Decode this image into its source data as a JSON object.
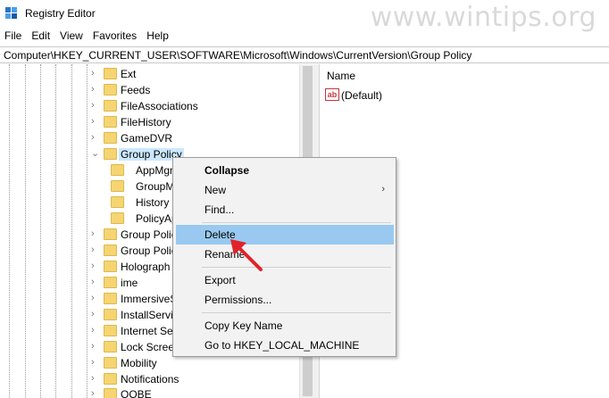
{
  "window": {
    "title": "Registry Editor",
    "watermark": "www.wintips.org"
  },
  "menu": [
    "File",
    "Edit",
    "View",
    "Favorites",
    "Help"
  ],
  "address": "Computer\\HKEY_CURRENT_USER\\SOFTWARE\\Microsoft\\Windows\\CurrentVersion\\Group Policy",
  "tree": {
    "items": [
      {
        "label": "Ext",
        "expander": "›"
      },
      {
        "label": "Feeds",
        "expander": "›"
      },
      {
        "label": "FileAssociations",
        "expander": "›"
      },
      {
        "label": "FileHistory",
        "expander": "›"
      },
      {
        "label": "GameDVR",
        "expander": "›"
      },
      {
        "label": "Group Policy",
        "expander": "⌄"
      },
      {
        "label": "Group Polic",
        "expander": "›"
      },
      {
        "label": "Group Polic",
        "expander": "›"
      },
      {
        "label": "Holograph",
        "expander": "›"
      },
      {
        "label": "ime",
        "expander": "›"
      },
      {
        "label": "ImmersiveS",
        "expander": "›"
      },
      {
        "label": "InstallServi",
        "expander": "›"
      },
      {
        "label": "Internet Set",
        "expander": "›"
      },
      {
        "label": "Lock Screen",
        "expander": "›"
      },
      {
        "label": "Mobility",
        "expander": "›"
      },
      {
        "label": "Notifications",
        "expander": "›"
      },
      {
        "label": "OOBE",
        "expander": "›"
      }
    ],
    "subitems": [
      {
        "label": "AppMgm"
      },
      {
        "label": "GroupM"
      },
      {
        "label": "History"
      },
      {
        "label": "PolicyAp"
      }
    ]
  },
  "values": {
    "column_name": "Name",
    "icon_text": "ab",
    "rows": [
      {
        "name": "(Default)"
      }
    ]
  },
  "context_menu": {
    "items": [
      {
        "label": "Collapse"
      },
      {
        "label": "New",
        "submenu_arrow": "›"
      },
      {
        "label": "Find..."
      },
      {
        "label": "Delete"
      },
      {
        "label": "Rename"
      },
      {
        "label": "Export"
      },
      {
        "label": "Permissions..."
      },
      {
        "label": "Copy Key Name"
      },
      {
        "label": "Go to HKEY_LOCAL_MACHINE"
      }
    ]
  },
  "colors": {
    "highlight": "#99c9f0",
    "selection": "#cce8ff",
    "folder": "#f5d572",
    "annotation_arrow": "#e0232a"
  }
}
